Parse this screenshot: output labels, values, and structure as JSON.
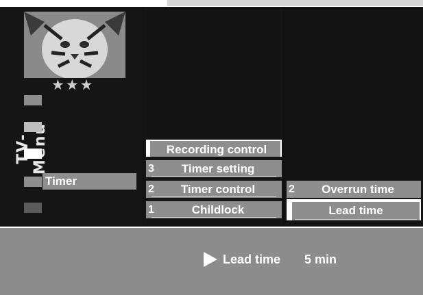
{
  "menu_title": "TV-Menü",
  "rating_stars": "★★★",
  "left_menu": {
    "selected_label": "Timer",
    "icons": [
      "menu-square-icon",
      "menu-square-icon",
      "menu-square-icon",
      "menu-square-icon",
      "menu-square-icon"
    ]
  },
  "middle_menu": {
    "items": [
      {
        "number": "",
        "label": "Recording control"
      },
      {
        "number": "3",
        "label": "Timer setting"
      },
      {
        "number": "2",
        "label": "Timer control"
      },
      {
        "number": "1",
        "label": "Childlock"
      }
    ]
  },
  "right_menu": {
    "items": [
      {
        "number": "2",
        "label": "Overrun time"
      },
      {
        "number": "",
        "label": "Lead time"
      }
    ]
  },
  "status": {
    "icon": "play-arrow-icon",
    "label": "Lead time",
    "value": "5 min"
  },
  "colors": {
    "panel": "#8c8c8c",
    "background": "#111111",
    "text": "#ffffff"
  }
}
